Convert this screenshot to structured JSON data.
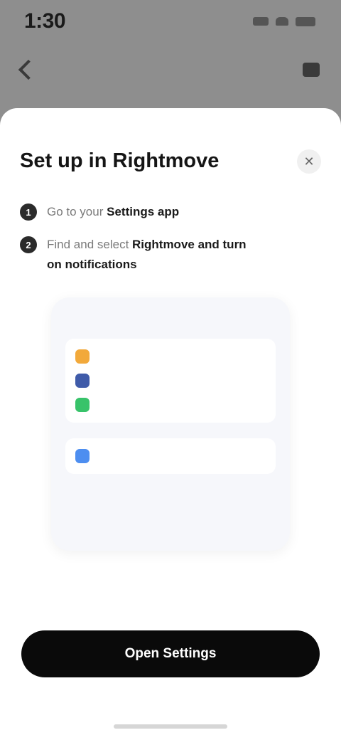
{
  "status": {
    "time": "1:30"
  },
  "background": {
    "title": ""
  },
  "sheet": {
    "title": "Set up in Rightmove",
    "description": "",
    "close_label": "✕",
    "steps": [
      {
        "num": "1",
        "text": "Go to your ",
        "bold": "Settings app"
      },
      {
        "num": "2",
        "text": "Find and select ",
        "bold": "Rightmove and turn on notifications"
      }
    ]
  },
  "preview": {
    "top_left": "",
    "top_right": "",
    "back": "",
    "title": "",
    "rows": [
      {
        "label": "",
        "color": "#f2a93b"
      },
      {
        "label": "",
        "color": "#3f5ba9"
      },
      {
        "label": "",
        "color": "#38c36a"
      }
    ],
    "section_label": "",
    "rows2": [
      {
        "label": "",
        "color": "#4d8ef0"
      }
    ]
  },
  "primary_button": {
    "label": "Open Settings"
  },
  "colors": {
    "accent": "#0a0a0a",
    "link": "#4d8ef0"
  }
}
